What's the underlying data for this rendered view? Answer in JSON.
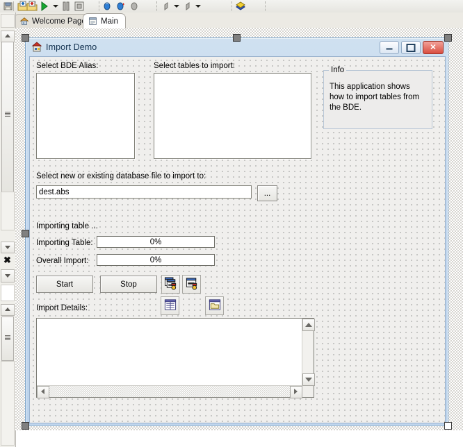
{
  "ide": {
    "close_tab_label": "✖",
    "toolbar_groups": [
      {
        "name": "file-group",
        "icons": [
          "save-all-icon",
          "open-project-icon",
          "save-project-icon"
        ]
      },
      {
        "name": "run-group",
        "icons": [
          "run-icon",
          "run-dropdown-icon",
          "pause-icon",
          "program-reset-icon"
        ]
      },
      {
        "name": "debug-group",
        "icons": [
          "trace-into-icon",
          "step-over-icon",
          "trace-to-source-icon"
        ]
      },
      {
        "name": "nav-group",
        "icons": [
          "back-icon",
          "back-dropdown-icon",
          "forward-icon",
          "forward-dropdown-icon"
        ]
      },
      {
        "name": "view-group",
        "icons": [
          "toggle-form-unit-icon"
        ]
      }
    ],
    "tabs": [
      {
        "label": "Welcome Page",
        "icon": "home-icon",
        "active": false
      },
      {
        "label": "Main",
        "icon": "form-icon",
        "active": true
      }
    ]
  },
  "form": {
    "title": "Import Demo",
    "icon": "import-demo-icon",
    "window_buttons": [
      {
        "name": "minimize-button",
        "glyph": "minimize-icon"
      },
      {
        "name": "maximize-button",
        "glyph": "maximize-icon"
      },
      {
        "name": "close-button",
        "glyph": "close-icon",
        "color": "#d94d3f",
        "label": "✕"
      }
    ],
    "labels": {
      "alias": "Select BDE Alias:",
      "tables": "Select tables to import:",
      "destination": "Select new or existing database file to import to:",
      "importing_status": "Importing table ...",
      "importing_table": "Importing Table:",
      "overall_import": "Overall Import:",
      "import_details": "Import Details:"
    },
    "alias_listbox": {
      "items": []
    },
    "tables_listbox": {
      "items": []
    },
    "info_group": {
      "title": "Info",
      "text": "This application shows how to import tables from the BDE."
    },
    "destination_field": {
      "value": "dest.abs",
      "placeholder": ""
    },
    "browse_button": {
      "label": "..."
    },
    "progress": {
      "importing_table_percent": "0%",
      "overall_percent": "0%",
      "importing_table_value": 0,
      "overall_value": 0
    },
    "buttons": {
      "start": "Start",
      "stop": "Stop"
    },
    "icon_buttons": [
      {
        "name": "import-tables-icon",
        "tooltip": ""
      },
      {
        "name": "import-table-icon",
        "tooltip": ""
      },
      {
        "name": "view-grid-icon",
        "tooltip": ""
      },
      {
        "name": "open-folder-icon",
        "tooltip": ""
      }
    ],
    "memo": {
      "value": ""
    }
  },
  "colors": {
    "form_title": "#12314f",
    "close_button": "#d94d3f",
    "designer_bg": "#d6d4cf",
    "client_bg": "#f0efed"
  }
}
